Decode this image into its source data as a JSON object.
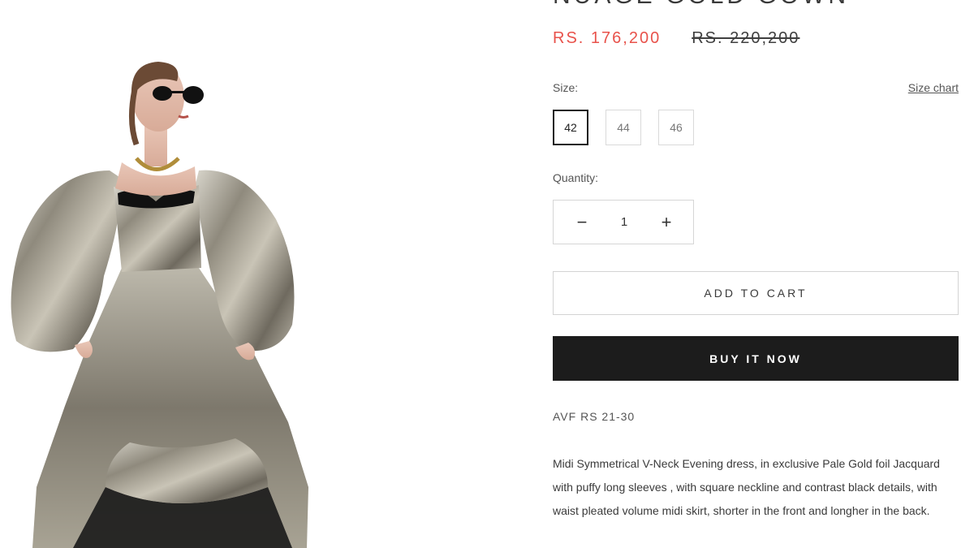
{
  "product": {
    "title": "NUAGE GOLD GOWN",
    "price_sale": "RS. 176,200",
    "price_compare": "RS. 220,200",
    "colors": {
      "sale": "#e8524b",
      "button_dark": "#1c1c1c"
    }
  },
  "size": {
    "label": "Size:",
    "chart_link": "Size chart",
    "options": [
      "42",
      "44",
      "46"
    ],
    "selected": "42"
  },
  "quantity": {
    "label": "Quantity:",
    "value": "1",
    "minus": "−",
    "plus": "+"
  },
  "buttons": {
    "add_to_cart": "ADD TO CART",
    "buy_now": "BUY IT NOW"
  },
  "sku": "AVF RS 21-30",
  "description": "Midi Symmetrical V-Neck Evening dress, in exclusive Pale Gold foil Jacquard with puffy long sleeves , with square neckline and contrast black details, with waist pleated volume midi skirt, shorter in the front and longher in the back.",
  "gallery": {
    "image_icon": "product-photo"
  }
}
